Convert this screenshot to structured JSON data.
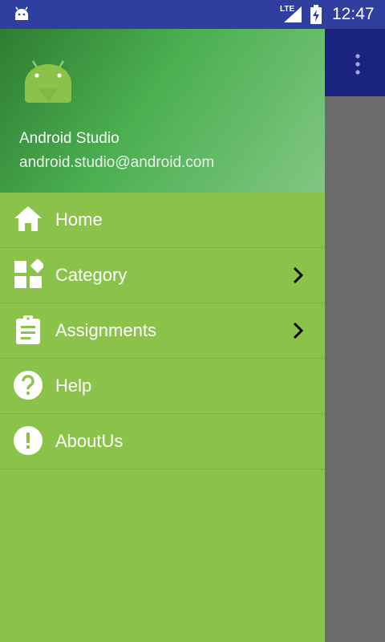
{
  "status_bar": {
    "network": "LTE",
    "time": "12:47",
    "icons": [
      "android-icon",
      "signal-icon",
      "battery-icon"
    ]
  },
  "app_bar": {
    "color": "#1a237e",
    "icons": [
      "overflow-menu-icon"
    ]
  },
  "drawer": {
    "background": "#8bc34a",
    "header": {
      "name": "Android Studio",
      "email": "android.studio@android.com",
      "icon": "android-logo-icon"
    },
    "items": [
      {
        "label": "Home",
        "icon": "home-icon",
        "has_submenu": false
      },
      {
        "label": "Category",
        "icon": "category-icon",
        "has_submenu": true
      },
      {
        "label": "Assignments",
        "icon": "assignment-icon",
        "has_submenu": true
      },
      {
        "label": "Help",
        "icon": "help-icon",
        "has_submenu": false
      },
      {
        "label": "AboutUs",
        "icon": "info-icon",
        "has_submenu": false
      }
    ]
  }
}
